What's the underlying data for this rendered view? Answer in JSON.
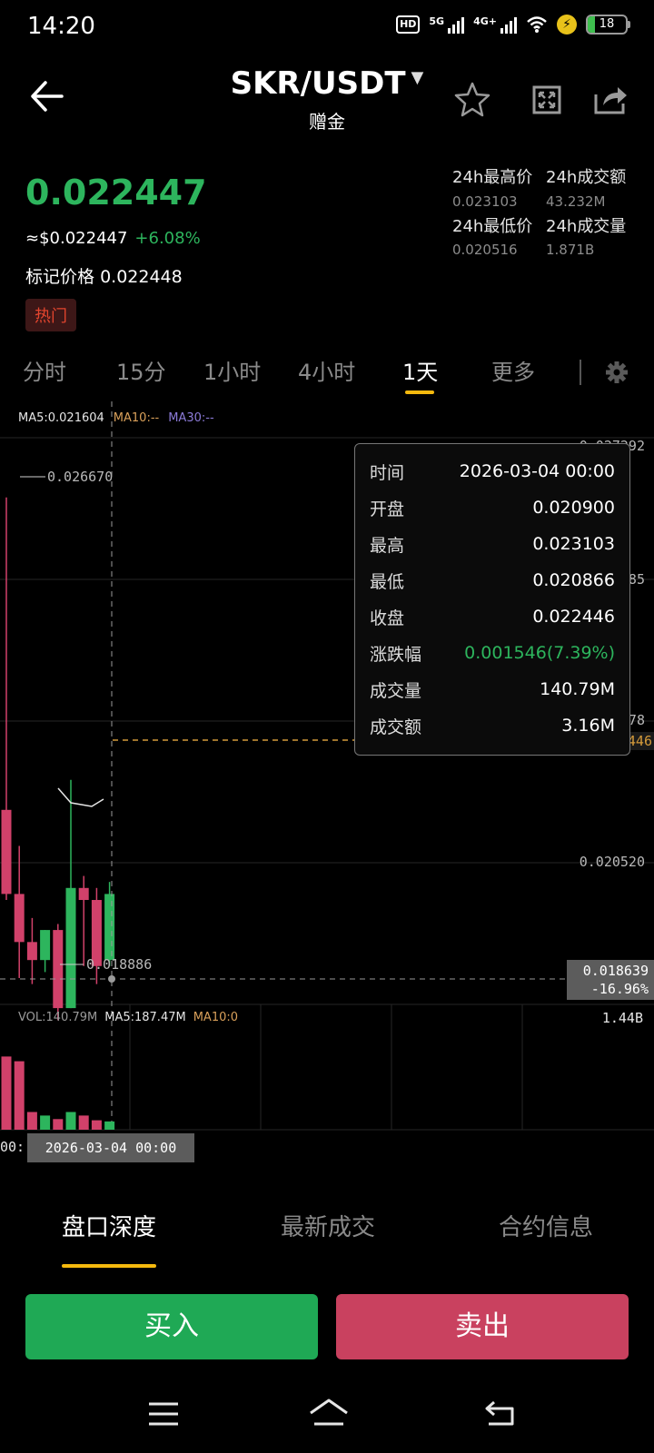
{
  "status_bar": {
    "time": "14:20",
    "network_badge": "HD",
    "signal_1_label": "5G",
    "signal_2_label": "4G+",
    "battery": 18
  },
  "header": {
    "pair": "SKR/USDT",
    "subtitle": "赠金"
  },
  "price": {
    "last": "0.022447",
    "usd": "≈$0.022447",
    "change": "+6.08%",
    "mark_label": "标记价格",
    "mark_value": "0.022448",
    "tag": "热门"
  },
  "stats": [
    {
      "label": "24h最高价",
      "value": "0.023103"
    },
    {
      "label": "24h成交额",
      "value": "43.232M"
    },
    {
      "label": "24h最低价",
      "value": "0.020516"
    },
    {
      "label": "24h成交量",
      "value": "1.871B"
    }
  ],
  "timeframes": {
    "items": [
      "分时",
      "15分",
      "1小时",
      "4小时",
      "1天",
      "更多"
    ],
    "active": "1天"
  },
  "ma_indicators": {
    "ma5": "MA5:0.021604",
    "ma10": "MA10:--",
    "ma30": "MA30:--"
  },
  "chart_data": {
    "type": "candlestick",
    "candles": [
      {
        "open": 0.0214,
        "close": 0.02,
        "high": 0.0266,
        "low": 0.0199
      },
      {
        "open": 0.02,
        "close": 0.0192,
        "high": 0.0208,
        "low": 0.0186
      },
      {
        "open": 0.0192,
        "close": 0.0189,
        "high": 0.0196,
        "low": 0.0185
      },
      {
        "open": 0.0189,
        "close": 0.0194,
        "high": 0.0194,
        "low": 0.0187
      },
      {
        "open": 0.0194,
        "close": 0.0181,
        "high": 0.0195,
        "low": 0.0179
      },
      {
        "open": 0.0181,
        "close": 0.0201,
        "high": 0.0219,
        "low": 0.0181
      },
      {
        "open": 0.0201,
        "close": 0.0199,
        "high": 0.0203,
        "low": 0.0188
      },
      {
        "open": 0.0199,
        "close": 0.0188,
        "high": 0.0201,
        "low": 0.0185
      },
      {
        "open": 0.0189,
        "close": 0.02,
        "high": 0.0202,
        "low": 0.0188
      }
    ],
    "price_axis": [
      "0.027292",
      "0.025185",
      "0.022878",
      "0.020520"
    ],
    "high_marker": "0.026670",
    "low_marker": "0.018886",
    "crosshair_price": "0.018639",
    "crosshair_pct": "-16.96%",
    "current_price_tag": "0.022446",
    "volume": {
      "vol_label": "VOL:140.79M",
      "ma5_label": "MA5:187.47M",
      "ma10_label": "MA10:0",
      "axis_max": "1.44B",
      "bars": [
        0.62,
        0.58,
        0.15,
        0.12,
        0.09,
        0.15,
        0.12,
        0.08,
        0.07
      ]
    },
    "crosshair_time": "2026-03-04 00:00",
    "left_axis_fragment": "00:"
  },
  "tooltip": [
    {
      "label": "时间",
      "value": "2026-03-04 00:00"
    },
    {
      "label": "开盘",
      "value": "0.020900"
    },
    {
      "label": "最高",
      "value": "0.023103"
    },
    {
      "label": "最低",
      "value": "0.020866"
    },
    {
      "label": "收盘",
      "value": "0.022446"
    },
    {
      "label": "涨跌幅",
      "value": "0.001546(7.39%)",
      "up": true
    },
    {
      "label": "成交量",
      "value": "140.79M"
    },
    {
      "label": "成交额",
      "value": "3.16M"
    }
  ],
  "bottom_tabs": {
    "items": [
      "盘口深度",
      "最新成交",
      "合约信息"
    ],
    "active": "盘口深度"
  },
  "actions": {
    "buy": "买入",
    "sell": "卖出"
  },
  "colors": {
    "up": "#2db55d",
    "down": "#d1416a",
    "accent": "#f5b90e"
  }
}
